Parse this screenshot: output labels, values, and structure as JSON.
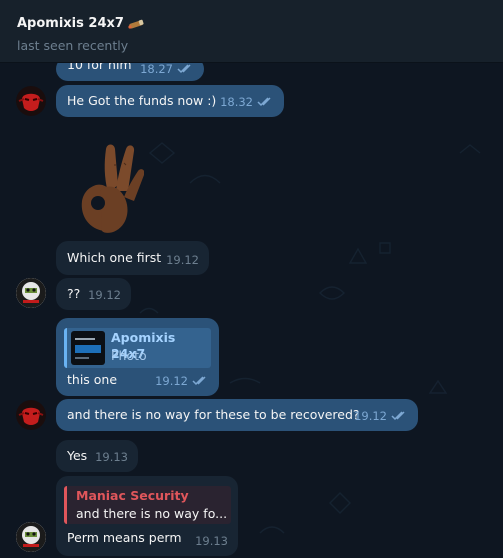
{
  "header": {
    "title": "Apomixis 24x7",
    "status": "last seen recently"
  },
  "messages": [
    {
      "text": "10 for him",
      "time": "18.27"
    },
    {
      "text": "He Got the funds now :)",
      "time": "18.32"
    },
    {
      "text": "Which one first",
      "time": "19.12"
    },
    {
      "text": "??",
      "time": "19.12"
    },
    {
      "quote_name": "Apomixis 24x7",
      "quote_text": "Photo",
      "text": "this one",
      "time": "19.12"
    },
    {
      "text": "and there is no way for these to be recovered?",
      "time": "19.12"
    },
    {
      "text": "Yes",
      "time": "19.13"
    },
    {
      "quote_name": "Maniac Security",
      "quote_text": "and there is no way fo...",
      "text": "Perm means perm",
      "time": "19.13"
    }
  ],
  "colors": {
    "background": "#0e1621",
    "header": "#17212b",
    "outgoing": "#2b5278",
    "incoming": "#182533",
    "quote_accent": "#e0565b",
    "link_accent": "#6ab3f3"
  }
}
